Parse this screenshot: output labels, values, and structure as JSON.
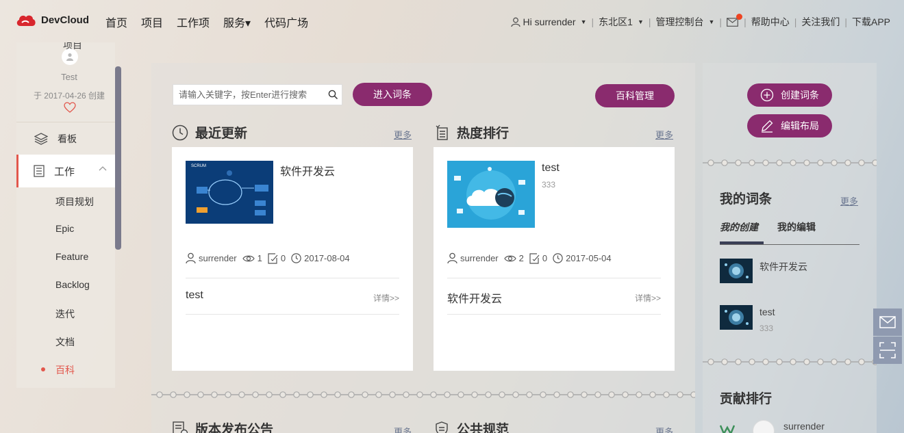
{
  "brand": {
    "name": "DevCloud"
  },
  "nav": {
    "items": [
      "首页",
      "项目",
      "工作项",
      "服务▾",
      "代码广场"
    ]
  },
  "topright": {
    "user": "Hi  surrender",
    "region": "东北区1",
    "console": "管理控制台",
    "help": "帮助中心",
    "follow": "关注我们",
    "download": "下载APP"
  },
  "sidebar": {
    "project_title": "项目",
    "project_name": "Test",
    "created": "于 2017-04-26 创建",
    "board_label": "看板",
    "work_label": "工作",
    "sub_items": [
      "项目规划",
      "Epic",
      "Feature",
      "Backlog",
      "迭代",
      "文档",
      "百科"
    ]
  },
  "search": {
    "placeholder": "请输入关键字，按Enter进行搜索"
  },
  "buttons": {
    "enter": "进入词条",
    "manage": "百科管理",
    "create": "创建词条",
    "edit_layout": "编辑布局"
  },
  "sections": {
    "recent": {
      "title": "最近更新",
      "more": "更多"
    },
    "hot": {
      "title": "热度排行",
      "more": "更多"
    },
    "release": {
      "title": "版本发布公告",
      "more": "更多"
    },
    "public": {
      "title": "公共规范",
      "more": "更多"
    }
  },
  "recent_card": {
    "title": "软件开发云",
    "user": "surrender",
    "views": "1",
    "edits": "0",
    "date": "2017-08-04",
    "footer": "test",
    "detail": "详情>>"
  },
  "hot_card": {
    "title": "test",
    "sub": "333",
    "user": "surrender",
    "views": "2",
    "edits": "0",
    "date": "2017-05-04",
    "footer": "软件开发云",
    "detail": "详情>>"
  },
  "my_entries": {
    "title": "我的词条",
    "more": "更多",
    "tabs": [
      "我的创建",
      "我的编辑"
    ],
    "items": [
      {
        "title": "软件开发云",
        "sub": ""
      },
      {
        "title": "test",
        "sub": "333"
      }
    ]
  },
  "ranking": {
    "title": "贡献排行",
    "top_user": "surrender"
  },
  "colors": {
    "accent": "#8a2b6e",
    "active_red": "#e2574c"
  }
}
